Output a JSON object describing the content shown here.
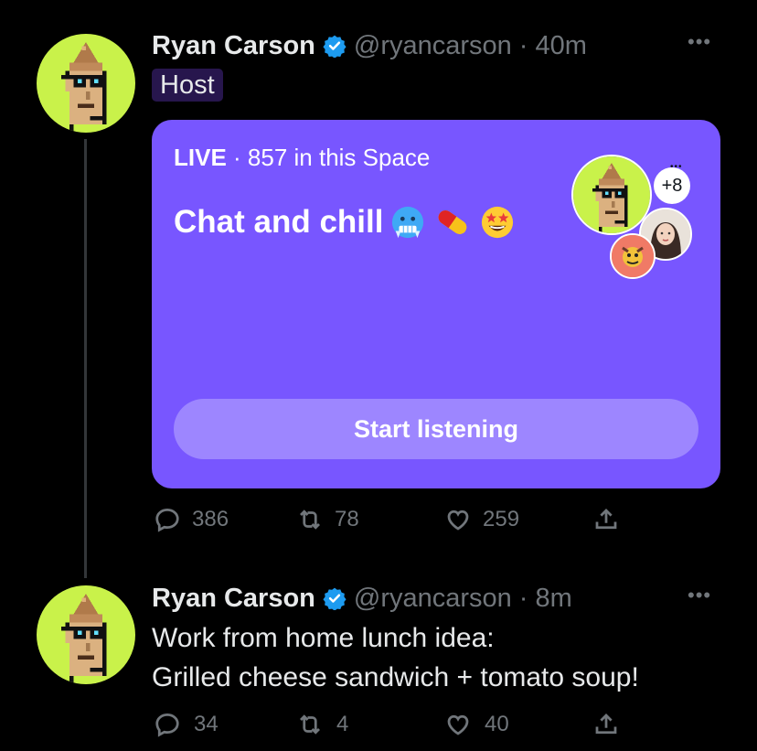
{
  "tweet1": {
    "author_name": "Ryan Carson",
    "handle": "@ryancarson",
    "time": "· 40m",
    "more": "•••",
    "badge": "Host",
    "space": {
      "live_label": "LIVE",
      "listener_text": "· 857 in this Space",
      "title": "Chat and chill",
      "emojis": [
        "cold-face",
        "pill",
        "star-struck"
      ],
      "extra_count": "+8",
      "button_label": "Start listening"
    },
    "actions": {
      "replies": "386",
      "retweets": "78",
      "likes": "259"
    }
  },
  "tweet2": {
    "author_name": "Ryan Carson",
    "handle": "@ryancarson",
    "time": "· 8m",
    "more": "•••",
    "text_line1": "Work from home lunch idea:",
    "text_line2": "Grilled cheese sandwich + tomato soup!",
    "actions": {
      "replies": "34",
      "retweets": "4",
      "likes": "40"
    }
  },
  "colors": {
    "background": "#000000",
    "space_card": "#7856ff",
    "verified": "#1d9bf0",
    "muted": "#71767b",
    "avatar_bg": "#c6f14a"
  }
}
